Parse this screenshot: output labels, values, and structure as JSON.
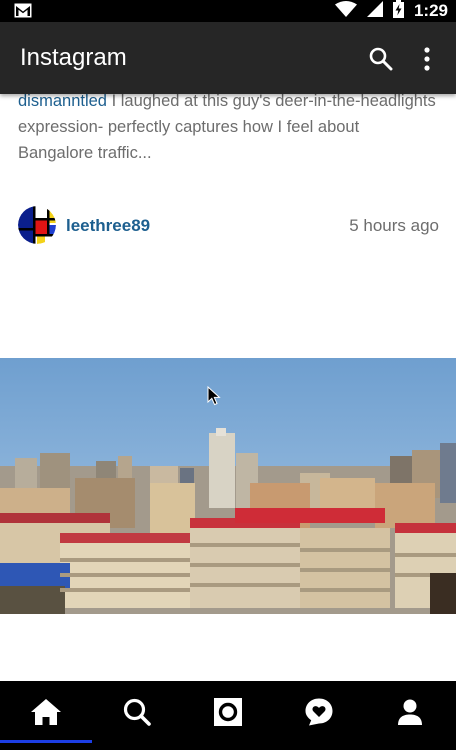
{
  "status_bar": {
    "time": "1:29",
    "icons": [
      "gmail-icon",
      "wifi-icon",
      "cellular-icon",
      "battery-charging-icon"
    ]
  },
  "app_bar": {
    "title": "Instagram",
    "icons": [
      "search-icon",
      "more-vert-icon"
    ]
  },
  "feed": {
    "previous_comment": {
      "username": "dismanntled",
      "text": " I laughed at this guy's deer-in-the-headlights expression- perfectly captures how I feel about Bangalore traffic..."
    },
    "post": {
      "username": "leethree89",
      "time_ago": "5 hours ago",
      "avatar": "mondrian-avatar",
      "photo": "city-skyline-photo"
    }
  },
  "bottom_nav": {
    "items": [
      "home-icon",
      "search-icon",
      "camera-icon",
      "activity-heart-icon",
      "profile-icon"
    ],
    "active": "home-icon",
    "active_color": "#1c3ee6"
  },
  "colors": {
    "app_bar": "#262626",
    "username_link": "#1d5f8f",
    "secondary_text": "#6d6d6d"
  }
}
